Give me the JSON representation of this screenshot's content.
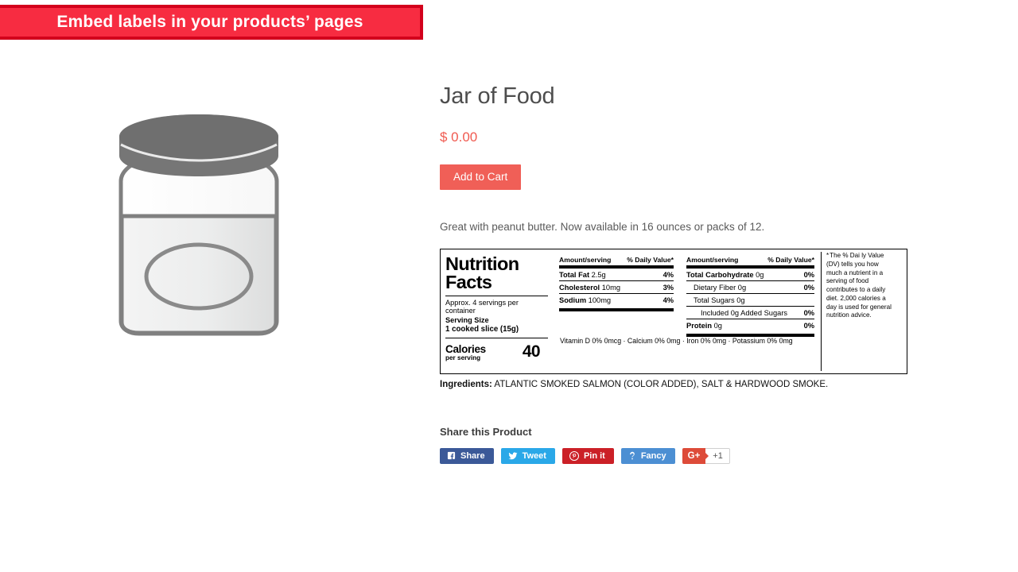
{
  "banner": {
    "text": "Embed labels in your products’ pages",
    "bg": "#f72c41",
    "border": "#d3001c"
  },
  "product": {
    "image_alt": "jar-of-food-illustration",
    "title": "Jar of Food",
    "price": "$ 0.00",
    "add_to_cart_label": "Add to Cart",
    "description": "Great with peanut butter. Now available in 16 ounces or packs of 12.",
    "accent_color": "#f05f57"
  },
  "nutrition": {
    "title_line1": "Nutrition",
    "title_line2": "Facts",
    "servings_per_container": "Approx. 4 servings per container",
    "serving_size_label": "Serving Size",
    "serving_size_value": "1 cooked slice (15g)",
    "calories_word": "Calories",
    "calories_sub": "per serving",
    "calories_value": "40",
    "col1_header_amount": "Amount/serving",
    "col1_header_dv": "% Daily Value*",
    "col2_header_amount": "Amount/serving",
    "col2_header_dv": "% Daily Value*",
    "column1": [
      {
        "name": "Total Fat",
        "amount": "2.5g",
        "dv": "4%",
        "bold": true,
        "indent": 0
      },
      {
        "name": "Cholesterol",
        "amount": "10mg",
        "dv": "3%",
        "bold": true,
        "indent": 0
      },
      {
        "name": "Sodium",
        "amount": "100mg",
        "dv": "4%",
        "bold": true,
        "indent": 0
      }
    ],
    "column2": [
      {
        "name": "Total Carbohydrate",
        "amount": "0g",
        "dv": "0%",
        "bold": true,
        "indent": 0
      },
      {
        "name": "Dietary Fiber",
        "amount": "0g",
        "dv": "0%",
        "bold": false,
        "indent": 1
      },
      {
        "name": "Total Sugars",
        "amount": "0g",
        "dv": "",
        "bold": false,
        "indent": 1
      },
      {
        "name": "Included 0g Added Sugars",
        "amount": "",
        "dv": "0%",
        "bold": false,
        "indent": 2
      },
      {
        "name": "Protein",
        "amount": "0g",
        "dv": "0%",
        "bold": true,
        "indent": 0
      }
    ],
    "vitamins": "Vitamin D 0% 0mcg · Calcium 0% 0mg · Iron 0% 0mg · Potassium 0% 0mg",
    "footnote_star": "*",
    "footnote": "The % Dai ly Value (DV) tells you how much a nutrient in a serving of food contributes to a daily diet. 2,000 calories a day is used for general nutrition advice.",
    "ingredients_label": "Ingredients:",
    "ingredients_value": "ATLANTIC SMOKED SALMON (COLOR ADDED), SALT & HARDWOOD SMOKE."
  },
  "share": {
    "heading": "Share this Product",
    "buttons": [
      {
        "id": "facebook",
        "label": "Share",
        "icon": "facebook-icon",
        "color": "#3b5998"
      },
      {
        "id": "twitter",
        "label": "Tweet",
        "icon": "twitter-icon",
        "color": "#2aa8e8"
      },
      {
        "id": "pinterest",
        "label": "Pin it",
        "icon": "pinterest-icon",
        "color": "#cb2027"
      },
      {
        "id": "fancy",
        "label": "Fancy",
        "icon": "fancy-icon",
        "color": "#4c8fd3"
      }
    ],
    "gplus": {
      "label": "G+",
      "count": "+1",
      "color": "#dd4b39"
    }
  }
}
